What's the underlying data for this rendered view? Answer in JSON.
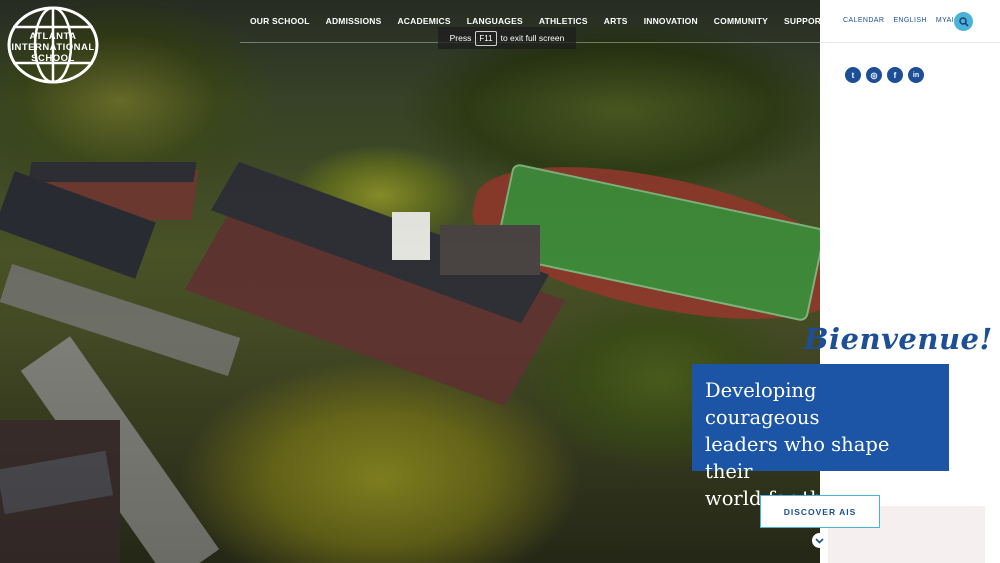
{
  "logo": {
    "line1": "ATLANTA",
    "line2": "INTERNATIONAL",
    "line3": "SCHOOL"
  },
  "nav": [
    "OUR SCHOOL",
    "ADMISSIONS",
    "ACADEMICS",
    "LANGUAGES",
    "ATHLETICS",
    "ARTS",
    "INNOVATION",
    "COMMUNITY",
    "SUPPORT"
  ],
  "fullscreen_notice": {
    "prefix": "Press",
    "key": "F11",
    "suffix": "to exit full screen"
  },
  "utility": {
    "calendar": "CALENDAR",
    "english": "ENGLISH",
    "myais": "MYAIS"
  },
  "search": {
    "icon": "search-icon"
  },
  "socials": [
    {
      "name": "twitter-icon",
      "glyph": "t"
    },
    {
      "name": "instagram-icon",
      "glyph": "◎"
    },
    {
      "name": "facebook-icon",
      "glyph": "f"
    },
    {
      "name": "linkedin-icon",
      "glyph": "in"
    }
  ],
  "hero": {
    "greeting": "Bienvenue!",
    "tagline_lines": [
      "Developing courageous",
      "leaders who shape their",
      "world for the better"
    ],
    "cta": "DISCOVER AIS",
    "scroll_icon": "chevron-down-icon"
  },
  "colors": {
    "brand_blue": "#1c55a5",
    "link_blue": "#1c4f95",
    "accent_cyan": "#4ab3d8"
  }
}
